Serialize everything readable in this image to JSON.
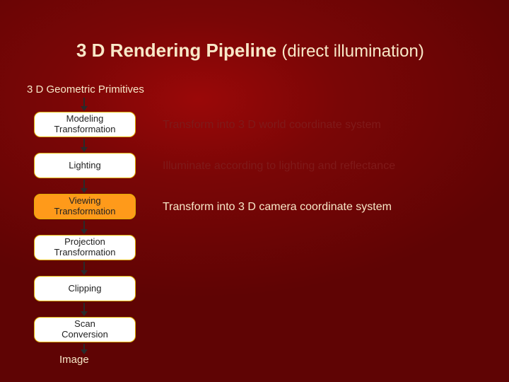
{
  "title": {
    "main": "3 D Rendering Pipeline",
    "sub": "(direct illumination)"
  },
  "start_label": "3 D Geometric Primitives",
  "end_label": "Image",
  "stages": [
    {
      "label": "Modeling\nTransformation",
      "desc": "Transform into 3 D world coordinate system",
      "dim": true,
      "highlight": false
    },
    {
      "label": "Lighting",
      "desc": "Illuminate according to lighting and reflectance",
      "dim": true,
      "highlight": false
    },
    {
      "label": "Viewing\nTransformation",
      "desc": "Transform into 3 D camera coordinate system",
      "dim": false,
      "highlight": true
    },
    {
      "label": "Projection\nTransformation",
      "desc": "",
      "dim": false,
      "highlight": false
    },
    {
      "label": "Clipping",
      "desc": "",
      "dim": false,
      "highlight": false
    },
    {
      "label": "Scan\nConversion",
      "desc": "",
      "dim": false,
      "highlight": false
    }
  ]
}
